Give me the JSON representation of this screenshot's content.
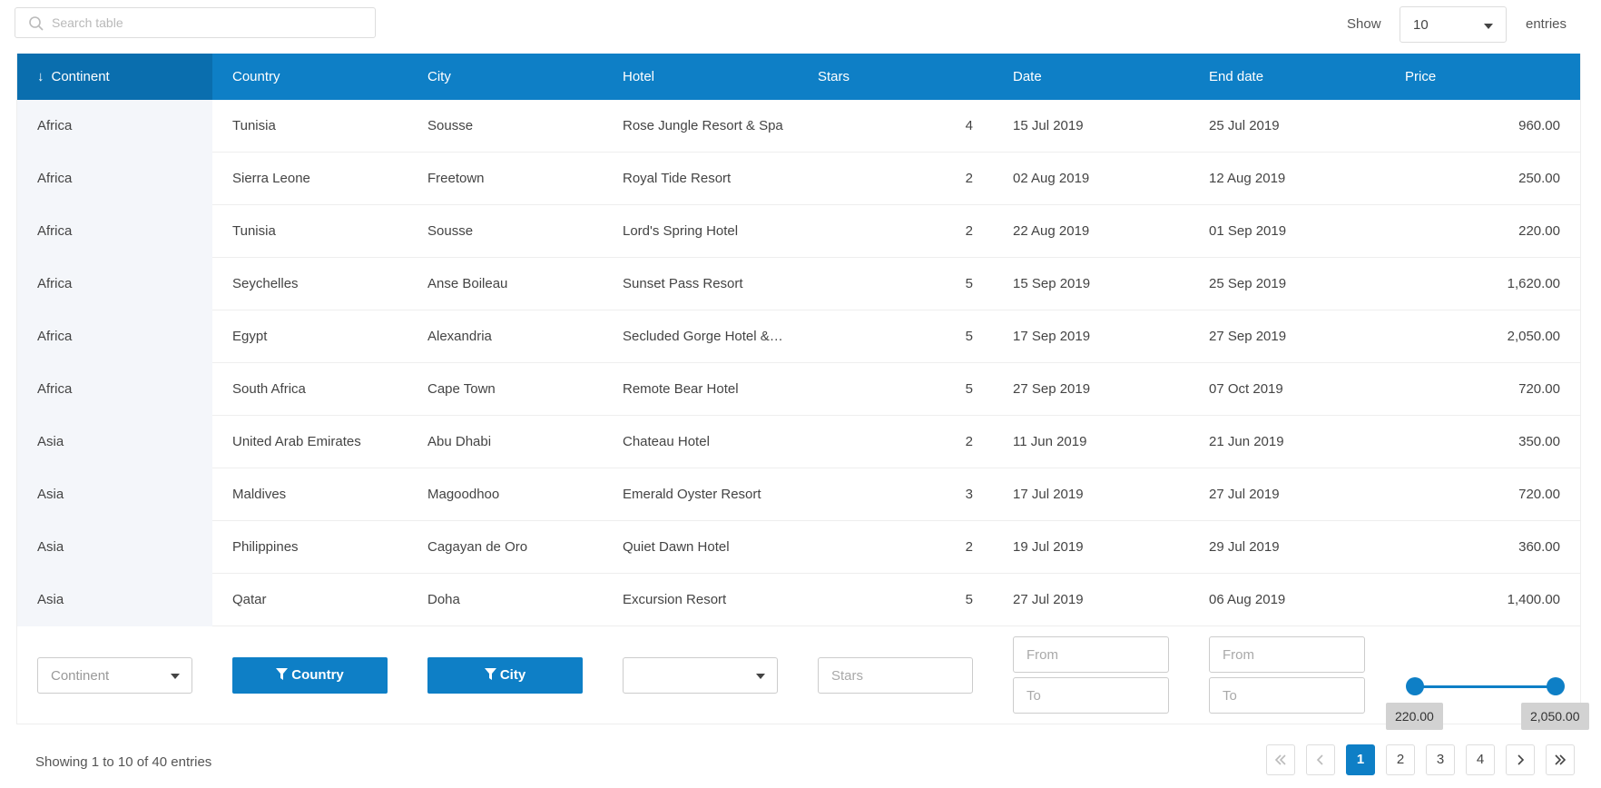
{
  "search": {
    "placeholder": "Search table"
  },
  "page_size": {
    "show_label": "Show",
    "value": "10",
    "entries_label": "entries"
  },
  "columns": [
    {
      "label": "Continent",
      "sorted": "desc"
    },
    {
      "label": "Country"
    },
    {
      "label": "City"
    },
    {
      "label": "Hotel"
    },
    {
      "label": "Stars"
    },
    {
      "label": "Date"
    },
    {
      "label": "End date"
    },
    {
      "label": "Price"
    }
  ],
  "rows": [
    [
      "Africa",
      "Tunisia",
      "Sousse",
      "Rose Jungle Resort & Spa",
      "4",
      "15 Jul 2019",
      "25 Jul 2019",
      "960.00"
    ],
    [
      "Africa",
      "Sierra Leone",
      "Freetown",
      "Royal Tide Resort",
      "2",
      "02 Aug 2019",
      "12 Aug 2019",
      "250.00"
    ],
    [
      "Africa",
      "Tunisia",
      "Sousse",
      "Lord's Spring Hotel",
      "2",
      "22 Aug 2019",
      "01 Sep 2019",
      "220.00"
    ],
    [
      "Africa",
      "Seychelles",
      "Anse Boileau",
      "Sunset Pass Resort",
      "5",
      "15 Sep 2019",
      "25 Sep 2019",
      "1,620.00"
    ],
    [
      "Africa",
      "Egypt",
      "Alexandria",
      "Secluded Gorge Hotel &…",
      "5",
      "17 Sep 2019",
      "27 Sep 2019",
      "2,050.00"
    ],
    [
      "Africa",
      "South Africa",
      "Cape Town",
      "Remote Bear Hotel",
      "5",
      "27 Sep 2019",
      "07 Oct 2019",
      "720.00"
    ],
    [
      "Asia",
      "United Arab Emirates",
      "Abu Dhabi",
      "Chateau Hotel",
      "2",
      "11 Jun 2019",
      "21 Jun 2019",
      "350.00"
    ],
    [
      "Asia",
      "Maldives",
      "Magoodhoo",
      "Emerald Oyster Resort",
      "3",
      "17 Jul 2019",
      "27 Jul 2019",
      "720.00"
    ],
    [
      "Asia",
      "Philippines",
      "Cagayan de Oro",
      "Quiet Dawn Hotel",
      "2",
      "19 Jul 2019",
      "29 Jul 2019",
      "360.00"
    ],
    [
      "Asia",
      "Qatar",
      "Doha",
      "Excursion Resort",
      "5",
      "27 Jul 2019",
      "06 Aug 2019",
      "1,400.00"
    ]
  ],
  "filters": {
    "continent_placeholder": "Continent",
    "country_button": "Country",
    "city_button": "City",
    "hotel_value": "",
    "stars_placeholder": "Stars",
    "date_from_placeholder": "From",
    "date_to_placeholder": "To",
    "end_from_placeholder": "From",
    "end_to_placeholder": "To",
    "price_min": "220.00",
    "price_max": "2,050.00"
  },
  "footer": {
    "showing_text": "Showing 1 to 10 of 40 entries",
    "pages": [
      "1",
      "2",
      "3",
      "4"
    ],
    "current_page": "1"
  },
  "colors": {
    "accent": "#0e7fc6",
    "sorted_header": "#0a6eae",
    "first_column_bg": "#f4f6fa"
  },
  "icons": {
    "search": "search-icon",
    "first": "double-chevron-left-icon",
    "prev": "chevron-left-icon",
    "next": "chevron-right-icon",
    "last": "double-chevron-right-icon",
    "filter": "funnel-icon"
  }
}
